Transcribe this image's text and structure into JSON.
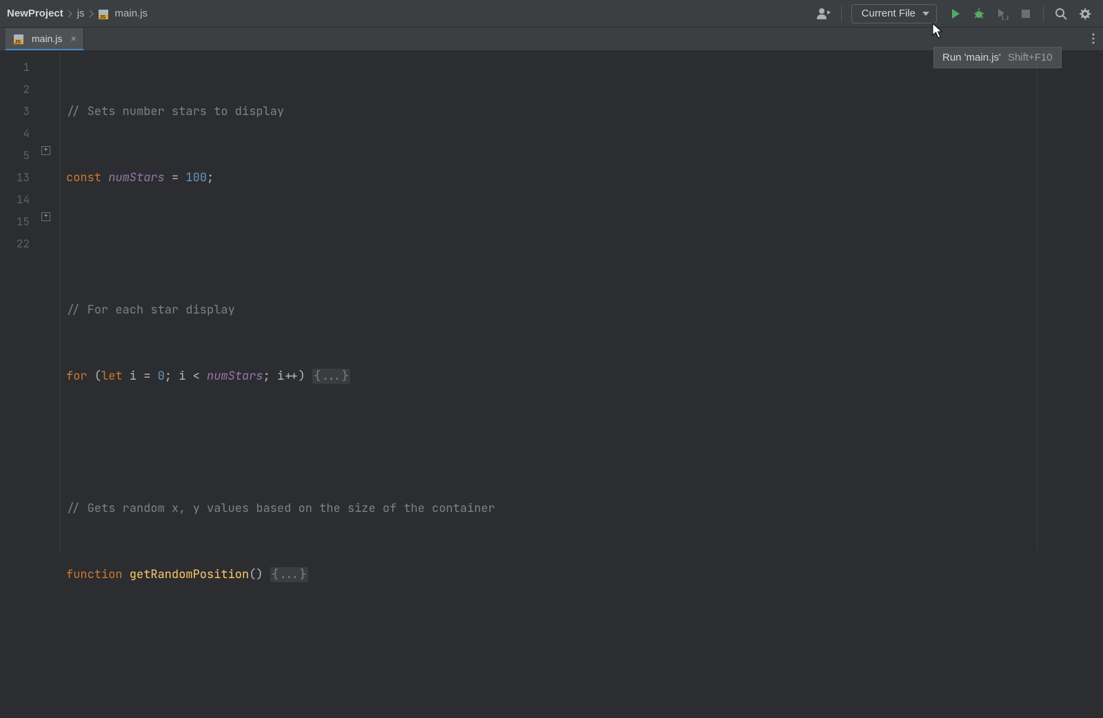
{
  "breadcrumbs": {
    "project": "NewProject",
    "folder": "js",
    "file": "main.js"
  },
  "run_config": {
    "label": "Current File"
  },
  "tab": {
    "label": "main.js"
  },
  "tooltip": {
    "label": "Run 'main.js'",
    "shortcut": "Shift+F10"
  },
  "editor": {
    "line_numbers": [
      "1",
      "2",
      "3",
      "4",
      "5",
      "13",
      "14",
      "15",
      "22"
    ],
    "lines": {
      "l1_comment": "// Sets number stars to display",
      "l2_kw": "const",
      "l2_ident": "numStars",
      "l2_eq": " = ",
      "l2_num": "100",
      "l2_semi": ";",
      "l4_comment": "// For each star display",
      "l5_kw1": "for",
      "l5_open": " (",
      "l5_kw2": "let",
      "l5_frag1": " i = ",
      "l5_num": "0",
      "l5_frag2": "; i < ",
      "l5_ident": "numStars",
      "l5_frag3": "; i++) ",
      "l5_fold": "{...}",
      "l7_comment": "// Gets random x, y values based on the size of the container",
      "l8_kw": "function",
      "l8_func": " getRandomPosition",
      "l8_paren": "() ",
      "l8_fold": "{...}"
    }
  }
}
